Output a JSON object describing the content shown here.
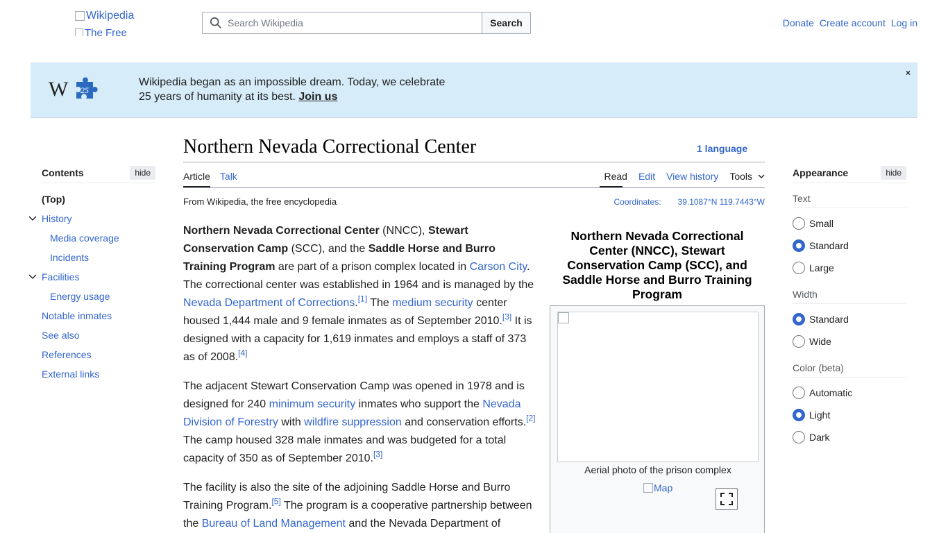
{
  "header": {
    "logo_alt": "Wikipedia",
    "logo_sub_alt": "The Free",
    "search_placeholder": "Search Wikipedia",
    "search_button": "Search",
    "user_links": [
      "Donate",
      "Create account",
      "Log in"
    ]
  },
  "banner": {
    "line1": "Wikipedia began as an impossible dream. Today, we celebrate",
    "line2": "25 years of humanity at its best.",
    "join": "Join us",
    "close": "×",
    "badge": "25"
  },
  "toc": {
    "title": "Contents",
    "hide": "hide",
    "items": [
      {
        "label": "(Top)",
        "level": "top"
      },
      {
        "label": "History",
        "level": "1",
        "collapsible": true
      },
      {
        "label": "Media coverage",
        "level": "2"
      },
      {
        "label": "Incidents",
        "level": "2"
      },
      {
        "label": "Facilities",
        "level": "1",
        "collapsible": true
      },
      {
        "label": "Energy usage",
        "level": "2"
      },
      {
        "label": "Notable inmates",
        "level": "1"
      },
      {
        "label": "See also",
        "level": "1"
      },
      {
        "label": "References",
        "level": "1"
      },
      {
        "label": "External links",
        "level": "1"
      }
    ]
  },
  "article": {
    "title": "Northern Nevada Correctional Center",
    "language": "1 language",
    "tabs_left": [
      "Article",
      "Talk"
    ],
    "tabs_right": [
      "Read",
      "Edit",
      "View history",
      "Tools"
    ],
    "from": "From Wikipedia, the free encyclopedia",
    "coords_label": "Coordinates:",
    "coords_value": "39.1087°N 119.7443°W"
  },
  "infobox": {
    "title": "Northern Nevada Correctional Center (NNCC), Stewart Conservation Camp (SCC), and Saddle Horse and Burro Training Program",
    "caption": "Aerial photo of the prison complex",
    "map": "Map"
  },
  "appearance": {
    "title": "Appearance",
    "hide": "hide",
    "groups": [
      {
        "label": "Text",
        "options": [
          "Small",
          "Standard",
          "Large"
        ],
        "selected": 1
      },
      {
        "label": "Width",
        "options": [
          "Standard",
          "Wide"
        ],
        "selected": 0
      },
      {
        "label": "Color (beta)",
        "options": [
          "Automatic",
          "Light",
          "Dark"
        ],
        "selected": 1
      }
    ]
  },
  "paragraphs": [
    [
      {
        "t": "Northern Nevada Correctional Center",
        "b": true
      },
      {
        "t": " (NNCC), "
      },
      {
        "t": "Stewart Conservation Camp",
        "b": true
      },
      {
        "t": " (SCC), and the "
      },
      {
        "t": "Saddle Horse and Burro Training Program",
        "b": true
      },
      {
        "t": " are part of a prison complex located in "
      },
      {
        "t": "Carson City",
        "link": true
      },
      {
        "t": ". The correctional center was established in 1964 and is managed by the "
      },
      {
        "t": "Nevada Department of Corrections",
        "link": true
      },
      {
        "t": ".",
        "nb": true
      },
      {
        "t": "[1]",
        "sup": true
      },
      {
        "t": " The "
      },
      {
        "t": "medium security",
        "link": true
      },
      {
        "t": " center housed 1,444 male and 9 female inmates as of September 2010."
      },
      {
        "t": "[3]",
        "sup": true
      },
      {
        "t": " It is designed with a capacity for 1,619 inmates and employs a staff of 373 as of 2008."
      },
      {
        "t": "[4]",
        "sup": true
      }
    ],
    [
      {
        "t": "The adjacent Stewart Conservation Camp was opened in 1978 and is designed for 240 "
      },
      {
        "t": "minimum security",
        "link": true
      },
      {
        "t": " inmates who support the "
      },
      {
        "t": "Nevada Division of Forestry",
        "link": true
      },
      {
        "t": " with "
      },
      {
        "t": "wildfire suppression",
        "link": true
      },
      {
        "t": " and conservation efforts."
      },
      {
        "t": "[2]",
        "sup": true
      },
      {
        "t": " The camp housed 328 male inmates and was budgeted for a total capacity of 350 as of September 2010."
      },
      {
        "t": "[3]",
        "sup": true
      }
    ],
    [
      {
        "t": "The facility is also the site of the adjoining Saddle Horse and Burro Training Program."
      },
      {
        "t": "[5]",
        "sup": true
      },
      {
        "t": " The program is a cooperative partnership between the "
      },
      {
        "t": "Bureau of Land Management",
        "link": true
      },
      {
        "t": " and the Nevada Department of"
      }
    ]
  ]
}
